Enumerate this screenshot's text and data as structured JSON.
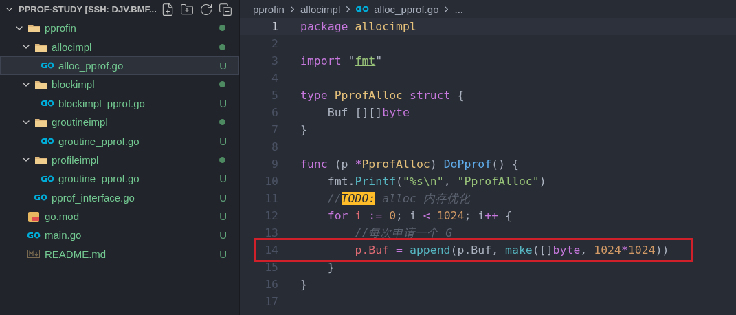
{
  "explorer": {
    "title": "PPROF-STUDY [SSH: DJV.BMF...",
    "expanded": true,
    "tree": [
      {
        "name": "pprofin",
        "kind": "folder",
        "expanded": true,
        "has_changes": true,
        "selected": false,
        "children": [
          {
            "name": "allocimpl",
            "kind": "folder",
            "expanded": true,
            "has_changes": true,
            "selected": false,
            "children": [
              {
                "name": "alloc_pprof.go",
                "kind": "go",
                "status": "U",
                "selected": true
              }
            ]
          },
          {
            "name": "blockimpl",
            "kind": "folder",
            "expanded": true,
            "has_changes": true,
            "selected": false,
            "children": [
              {
                "name": "blockimpl_pprof.go",
                "kind": "go",
                "status": "U",
                "selected": false
              }
            ]
          },
          {
            "name": "groutineimpl",
            "kind": "folder",
            "expanded": true,
            "has_changes": true,
            "selected": false,
            "children": [
              {
                "name": "groutine_pprof.go",
                "kind": "go",
                "status": "U",
                "selected": false
              }
            ]
          },
          {
            "name": "profileimpl",
            "kind": "folder",
            "expanded": true,
            "has_changes": true,
            "selected": false,
            "children": [
              {
                "name": "groutine_pprof.go",
                "kind": "go",
                "status": "U",
                "selected": false
              }
            ]
          },
          {
            "name": "pprof_interface.go",
            "kind": "go",
            "status": "U",
            "selected": false
          }
        ]
      },
      {
        "name": "go.mod",
        "kind": "mod",
        "status": "U",
        "selected": false
      },
      {
        "name": "main.go",
        "kind": "go",
        "status": "U",
        "selected": false
      },
      {
        "name": "README.md",
        "kind": "md",
        "status": "U",
        "selected": false
      }
    ]
  },
  "breadcrumb": [
    {
      "text": "pprofin",
      "kind": "folder"
    },
    {
      "text": "allocimpl",
      "kind": "folder"
    },
    {
      "text": "alloc_pprof.go",
      "kind": "go"
    },
    {
      "text": "...",
      "kind": "more"
    }
  ],
  "editor": {
    "lines": [
      {
        "number": "1",
        "current": true,
        "tokens": [
          {
            "text": "package ",
            "kind": "keyword"
          },
          {
            "text": "allocimpl",
            "kind": "type"
          }
        ]
      },
      {
        "number": "2",
        "current": false
      },
      {
        "number": "3",
        "current": false,
        "tokens": [
          {
            "text": "import ",
            "kind": "keyword"
          },
          {
            "text": "\"",
            "kind": "plain"
          },
          {
            "text": "fmt",
            "kind": "module"
          },
          {
            "text": "\"",
            "kind": "plain"
          }
        ]
      },
      {
        "number": "4",
        "current": false
      },
      {
        "number": "5",
        "current": false,
        "tokens": [
          {
            "text": "type ",
            "kind": "keyword"
          },
          {
            "text": "PprofAlloc ",
            "kind": "type"
          },
          {
            "text": "struct ",
            "kind": "keyword"
          },
          {
            "text": "{",
            "kind": "plain"
          }
        ]
      },
      {
        "number": "6",
        "current": false,
        "tokens": [
          {
            "text": "    Buf [][]",
            "kind": "plain"
          },
          {
            "text": "byte",
            "kind": "keyword"
          }
        ]
      },
      {
        "number": "7",
        "current": false,
        "tokens": [
          {
            "text": "}",
            "kind": "plain"
          }
        ]
      },
      {
        "number": "8",
        "current": false
      },
      {
        "number": "9",
        "current": false,
        "tokens": [
          {
            "text": "func ",
            "kind": "keyword"
          },
          {
            "text": "(p ",
            "kind": "plain"
          },
          {
            "text": "*",
            "kind": "keyword"
          },
          {
            "text": "PprofAlloc",
            "kind": "type"
          },
          {
            "text": ") ",
            "kind": "plain"
          },
          {
            "text": "DoPprof",
            "kind": "func"
          },
          {
            "text": "() {",
            "kind": "plain"
          }
        ]
      },
      {
        "number": "10",
        "current": false,
        "tokens": [
          {
            "text": "    fmt.",
            "kind": "plain"
          },
          {
            "text": "Printf",
            "kind": "call"
          },
          {
            "text": "(",
            "kind": "plain"
          },
          {
            "text": "\"%s\\n\"",
            "kind": "string"
          },
          {
            "text": ", ",
            "kind": "plain"
          },
          {
            "text": "\"PprofAlloc\"",
            "kind": "string"
          },
          {
            "text": ")",
            "kind": "plain"
          }
        ]
      },
      {
        "number": "11",
        "current": false,
        "tokens": [
          {
            "text": "    //",
            "kind": "comment"
          },
          {
            "text": "TODO:",
            "kind": "todo"
          },
          {
            "text": " alloc 内存优化",
            "kind": "comment"
          }
        ]
      },
      {
        "number": "12",
        "current": false,
        "tokens": [
          {
            "text": "    for ",
            "kind": "keyword"
          },
          {
            "text": "i ",
            "kind": "variable"
          },
          {
            "text": ":= ",
            "kind": "keyword"
          },
          {
            "text": "0",
            "kind": "number"
          },
          {
            "text": "; i ",
            "kind": "plain"
          },
          {
            "text": "< ",
            "kind": "keyword"
          },
          {
            "text": "1024",
            "kind": "number"
          },
          {
            "text": "; i",
            "kind": "plain"
          },
          {
            "text": "++",
            "kind": "keyword"
          },
          {
            "text": " {",
            "kind": "plain"
          }
        ]
      },
      {
        "number": "13",
        "current": false,
        "tokens": [
          {
            "text": "        //每次申请一个 G",
            "kind": "comment"
          }
        ]
      },
      {
        "number": "14",
        "current": false,
        "boxed": true,
        "tokens": [
          {
            "text": "        p.Buf ",
            "kind": "variable"
          },
          {
            "text": "= ",
            "kind": "keyword"
          },
          {
            "text": "append",
            "kind": "call"
          },
          {
            "text": "(p.Buf, ",
            "kind": "plain"
          },
          {
            "text": "make",
            "kind": "call"
          },
          {
            "text": "([]",
            "kind": "plain"
          },
          {
            "text": "byte",
            "kind": "keyword"
          },
          {
            "text": ", ",
            "kind": "plain"
          },
          {
            "text": "1024",
            "kind": "number"
          },
          {
            "text": "*",
            "kind": "keyword"
          },
          {
            "text": "1024",
            "kind": "number"
          },
          {
            "text": "))",
            "kind": "plain"
          }
        ]
      },
      {
        "number": "15",
        "current": false,
        "tokens": [
          {
            "text": "    }",
            "kind": "plain"
          }
        ]
      },
      {
        "number": "16",
        "current": false,
        "tokens": [
          {
            "text": "}",
            "kind": "plain"
          }
        ]
      },
      {
        "number": "17",
        "current": false
      }
    ]
  }
}
